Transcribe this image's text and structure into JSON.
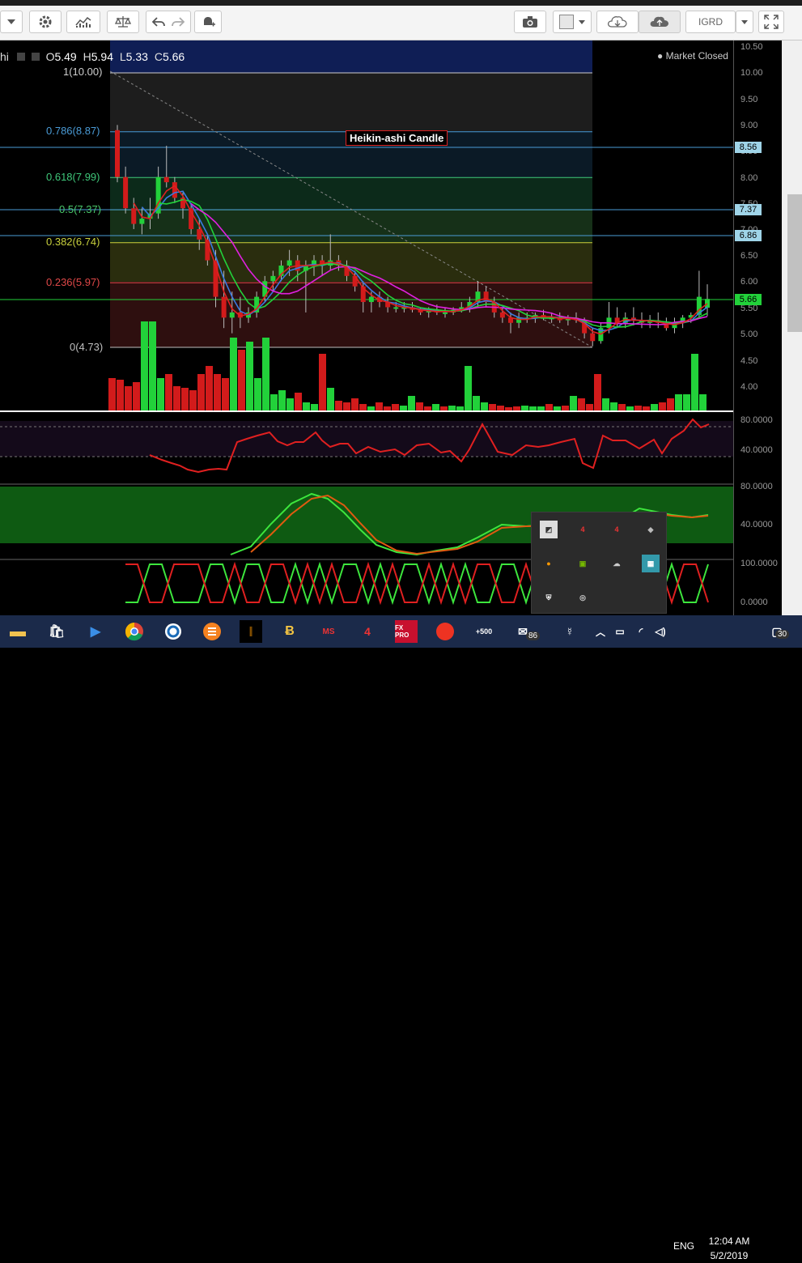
{
  "toolbar": {
    "symbol_box": "IGRD",
    "buttons": [
      "dropdown-caret",
      "gear",
      "chart-type",
      "scale",
      "undo",
      "redo",
      "alert",
      "camera",
      "color-box",
      "cloud-download",
      "cloud-upload",
      "symbol",
      "fullscreen"
    ]
  },
  "ohlc": {
    "prefix": "hi",
    "open_label": "O",
    "open": "5.49",
    "high_label": "H",
    "high": "5.94",
    "low_label": "L",
    "low": "5.33",
    "close_label": "C",
    "close": "5.66"
  },
  "market_status": "Market Closed",
  "chart_title": "Heikin-ashi Candle",
  "fib_levels": [
    {
      "label": "1(10.00)",
      "color": "#cfcfcf"
    },
    {
      "label": "0.786(8.87)",
      "color": "#4a9bd6"
    },
    {
      "label": "0.618(7.99)",
      "color": "#3fc77a"
    },
    {
      "label": "0.5(7.37)",
      "color": "#49c76a"
    },
    {
      "label": "0.382(6.74)",
      "color": "#c9d13d"
    },
    {
      "label": "0.236(5.97)",
      "color": "#e04848"
    },
    {
      "label": "0(4.73)",
      "color": "#bfbfbf"
    }
  ],
  "price_axis": [
    "10.50",
    "10.00",
    "9.50",
    "9.00",
    "8.50",
    "8.00",
    "7.50",
    "7.00",
    "6.50",
    "6.00",
    "5.50",
    "5.00",
    "4.50",
    "4.00"
  ],
  "price_tags": [
    "8.56",
    "7.37",
    "6.86",
    "5.66"
  ],
  "rsi_axis": [
    "80.0000",
    "40.0000"
  ],
  "stoch_axis": [
    "80.0000",
    "40.0000"
  ],
  "binary_axis": [
    "100.0000",
    "0.0000"
  ],
  "taskbar": {
    "badge_mail": "86",
    "language": "ENG",
    "time": "12:04 AM",
    "date": "5/2/2019",
    "notif_count": "30",
    "app_labels": [
      "MS",
      "FX PRO",
      "+500"
    ]
  },
  "colors": {
    "up": "#22d13a",
    "down": "#d21b1b",
    "fib_zone_top": "#0f1e55"
  },
  "chart_data": {
    "type": "candlestick",
    "title": "Heikin-ashi Candle",
    "ylim": [
      3.7,
      10.5
    ],
    "candles": [
      [
        8.9,
        9.0,
        7.9,
        8.0
      ],
      [
        8.0,
        8.2,
        7.3,
        7.4
      ],
      [
        7.4,
        7.6,
        7.0,
        7.1
      ],
      [
        7.1,
        7.4,
        6.9,
        7.2
      ],
      [
        7.2,
        7.6,
        7.0,
        7.3
      ],
      [
        7.3,
        8.2,
        7.2,
        8.0
      ],
      [
        8.0,
        8.6,
        7.8,
        7.9
      ],
      [
        7.9,
        8.0,
        7.5,
        7.6
      ],
      [
        7.6,
        7.7,
        7.2,
        7.4
      ],
      [
        7.4,
        7.5,
        6.9,
        7.0
      ],
      [
        7.0,
        7.2,
        6.6,
        6.8
      ],
      [
        6.8,
        6.9,
        6.3,
        6.4
      ],
      [
        6.4,
        6.6,
        5.5,
        5.7
      ],
      [
        5.7,
        6.2,
        5.1,
        5.3
      ],
      [
        5.3,
        5.8,
        5.0,
        5.4
      ],
      [
        5.4,
        5.7,
        5.1,
        5.3
      ],
      [
        5.3,
        5.5,
        5.2,
        5.4
      ],
      [
        5.4,
        5.8,
        5.3,
        5.7
      ],
      [
        5.7,
        6.1,
        5.6,
        6.0
      ],
      [
        6.0,
        6.2,
        5.8,
        6.1
      ],
      [
        6.1,
        6.4,
        6.0,
        6.3
      ],
      [
        6.3,
        6.6,
        6.1,
        6.4
      ],
      [
        6.4,
        6.5,
        6.0,
        6.2
      ],
      [
        6.2,
        6.4,
        5.4,
        6.3
      ],
      [
        6.3,
        6.5,
        6.1,
        6.4
      ],
      [
        6.4,
        6.5,
        6.1,
        6.3
      ],
      [
        6.3,
        6.9,
        6.2,
        6.4
      ],
      [
        6.4,
        6.5,
        6.2,
        6.3
      ],
      [
        6.3,
        6.4,
        6.0,
        6.1
      ],
      [
        6.1,
        6.2,
        5.8,
        5.9
      ],
      [
        5.9,
        6.0,
        5.4,
        5.6
      ],
      [
        5.6,
        5.8,
        5.4,
        5.7
      ],
      [
        5.7,
        5.8,
        5.5,
        5.6
      ],
      [
        5.6,
        5.7,
        5.4,
        5.5
      ],
      [
        5.5,
        5.6,
        5.4,
        5.5
      ],
      [
        5.5,
        5.6,
        5.4,
        5.5
      ],
      [
        5.5,
        5.6,
        5.4,
        5.45
      ],
      [
        5.45,
        5.5,
        5.35,
        5.4
      ],
      [
        5.4,
        5.5,
        5.3,
        5.45
      ],
      [
        5.45,
        5.55,
        5.35,
        5.4
      ],
      [
        5.4,
        5.5,
        5.3,
        5.4
      ],
      [
        5.4,
        5.5,
        5.35,
        5.45
      ],
      [
        5.45,
        5.6,
        5.4,
        5.5
      ],
      [
        5.5,
        5.7,
        5.4,
        5.6
      ],
      [
        5.6,
        6.0,
        5.5,
        5.8
      ],
      [
        5.8,
        5.9,
        5.5,
        5.6
      ],
      [
        5.6,
        5.7,
        5.3,
        5.4
      ],
      [
        5.4,
        5.5,
        5.2,
        5.3
      ],
      [
        5.3,
        5.4,
        5.0,
        5.2
      ],
      [
        5.2,
        5.4,
        5.1,
        5.3
      ],
      [
        5.3,
        5.4,
        5.2,
        5.3
      ],
      [
        5.3,
        5.4,
        5.2,
        5.35
      ],
      [
        5.35,
        5.45,
        5.25,
        5.3
      ],
      [
        5.3,
        5.4,
        5.2,
        5.3
      ],
      [
        5.3,
        5.4,
        5.2,
        5.25
      ],
      [
        5.25,
        5.35,
        5.15,
        5.3
      ],
      [
        5.3,
        5.4,
        5.2,
        5.25
      ],
      [
        5.25,
        5.3,
        4.9,
        5.0
      ],
      [
        5.0,
        5.1,
        4.75,
        4.85
      ],
      [
        4.85,
        5.2,
        4.8,
        5.1
      ],
      [
        5.1,
        5.6,
        5.0,
        5.3
      ],
      [
        5.3,
        5.5,
        5.1,
        5.2
      ],
      [
        5.2,
        5.4,
        5.1,
        5.3
      ],
      [
        5.3,
        5.5,
        5.15,
        5.25
      ],
      [
        5.25,
        5.4,
        5.1,
        5.2
      ],
      [
        5.2,
        5.35,
        5.1,
        5.25
      ],
      [
        5.25,
        5.4,
        5.1,
        5.2
      ],
      [
        5.2,
        5.3,
        5.05,
        5.1
      ],
      [
        5.1,
        5.3,
        5.0,
        5.2
      ],
      [
        5.2,
        5.35,
        5.1,
        5.3
      ],
      [
        5.3,
        5.4,
        5.2,
        5.35
      ],
      [
        5.35,
        6.2,
        5.3,
        5.7
      ],
      [
        5.49,
        5.94,
        5.33,
        5.66
      ]
    ]
  }
}
